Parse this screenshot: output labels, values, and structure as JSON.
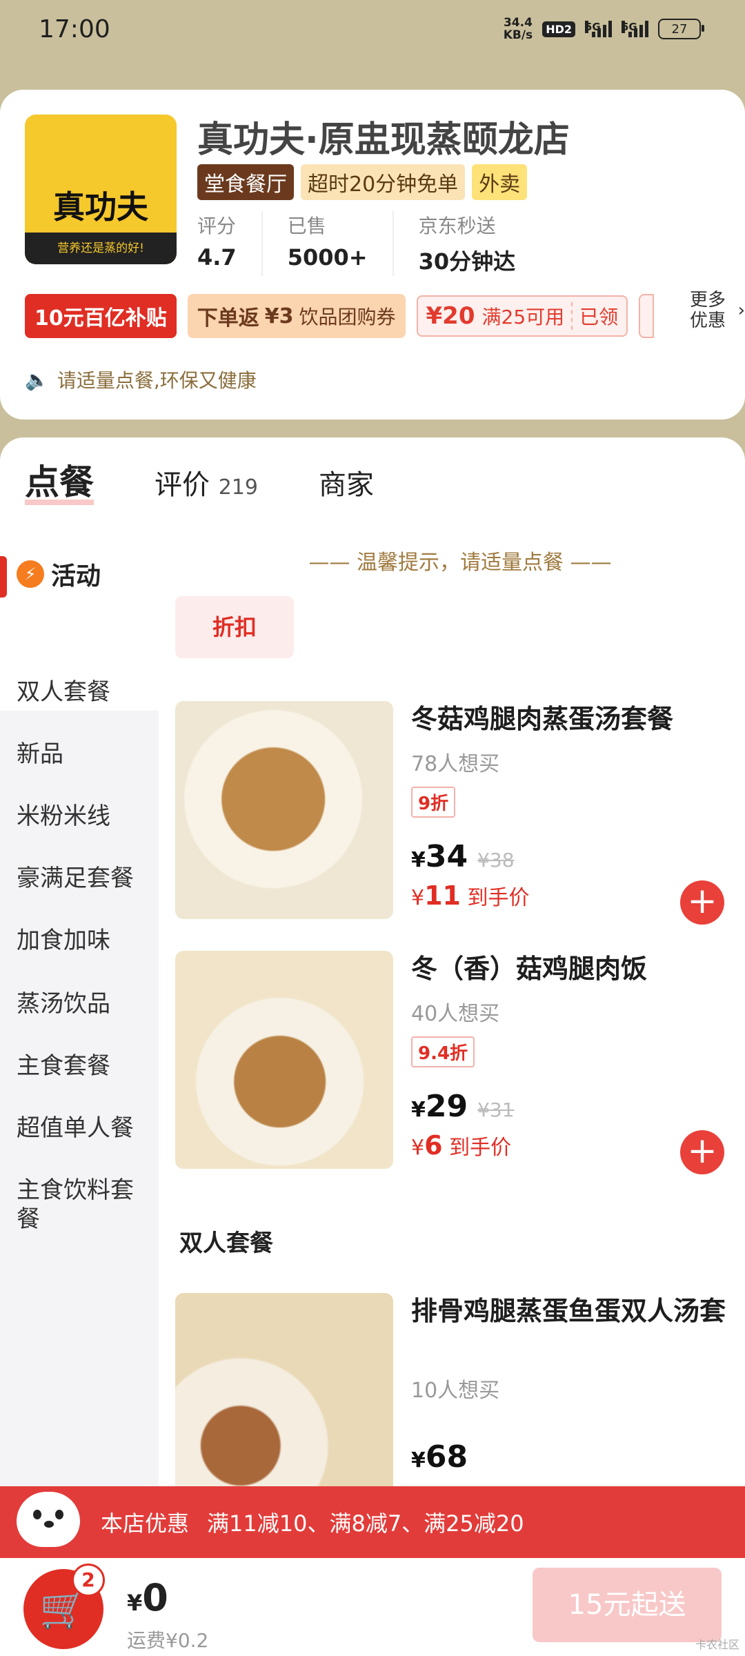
{
  "status": {
    "time": "17:00",
    "speed": "34.4",
    "speed_unit": "KB/s",
    "hd": "HD2",
    "sig1": "5G",
    "sig2": "5G",
    "battery": "27"
  },
  "store": {
    "name": "真功夫·原盅现蒸颐龙店",
    "logo_text": "真功夫",
    "logo_slogan": "营养还是蒸的好!",
    "tags": [
      "堂食餐厅",
      "超时20分钟免单",
      "外卖"
    ],
    "stats": [
      {
        "label": "评分",
        "value": "4.7"
      },
      {
        "label": "已售",
        "value": "5000+"
      },
      {
        "label": "京东秒送",
        "value": "30分钟达"
      }
    ],
    "promos": {
      "subsidy": "10元百亿补贴",
      "rebate_prefix": "下单返",
      "rebate_amount": "¥3",
      "rebate_desc": "饮品团购券",
      "coupon_amount": "¥20",
      "coupon_cond": "满25可用",
      "coupon_status": "已领",
      "more": "更多优惠"
    },
    "notice": "请适量点餐,环保又健康"
  },
  "tabs": [
    {
      "label": "点餐"
    },
    {
      "label": "评价",
      "count": "219"
    },
    {
      "label": "商家"
    }
  ],
  "sidebar": {
    "active": "活动",
    "items": [
      "双人套餐",
      "新品",
      "米粉米线",
      "豪满足套餐",
      "加食加味",
      "蒸汤饮品",
      "主食套餐",
      "超值单人餐",
      "主食饮料套餐"
    ]
  },
  "menu": {
    "tip": "—— 温馨提示，请适量点餐 ——",
    "chip": "折扣",
    "items": [
      {
        "title": "冬菇鸡腿肉蒸蛋汤套餐",
        "sales": "78人想买",
        "discount": "9折",
        "price": "34",
        "old_price": "¥38",
        "hand_price": "11",
        "hand_label": "到手价"
      },
      {
        "title": "冬（香）菇鸡腿肉饭",
        "sales": "40人想买",
        "discount": "9.4折",
        "price": "29",
        "old_price": "¥31",
        "hand_price": "6",
        "hand_label": "到手价"
      },
      {
        "title": "排骨鸡腿蒸蛋鱼蛋双人汤套",
        "sales": "10人想买",
        "price": "68"
      }
    ],
    "section_title": "双人套餐",
    "currency": "¥"
  },
  "promo_bar": {
    "label": "本店优惠",
    "text": "满11减10、满8减7、满25减20"
  },
  "cart": {
    "badge": "2",
    "total": "0",
    "delivery": "运费¥0.2",
    "checkout": "15元起送"
  },
  "watermark": "卡农社区"
}
